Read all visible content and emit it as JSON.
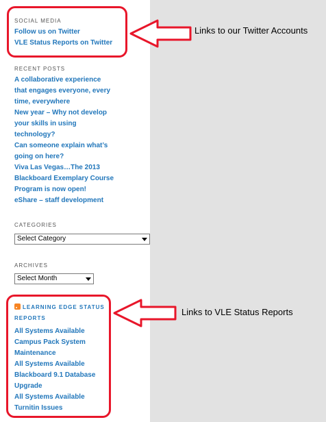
{
  "social_media": {
    "title": "SOCIAL MEDIA",
    "links": [
      "Follow us on Twitter",
      "VLE Status Reports on Twitter"
    ]
  },
  "recent_posts": {
    "title": "RECENT POSTS",
    "lines": [
      "A collaborative experience",
      "that engages everyone, every",
      "time, everywhere",
      "New year – Why not develop",
      "your skills in using",
      "technology?",
      "Can someone explain what’s",
      "going on here?",
      "Viva Las Vegas…The 2013",
      "Blackboard Exemplary Course",
      "Program is now open!",
      "eShare – staff development"
    ]
  },
  "categories": {
    "title": "CATEGORIES",
    "selected": "Select Category"
  },
  "archives": {
    "title": "ARCHIVES",
    "selected": "Select Month"
  },
  "status_reports": {
    "title": "LEARNING EDGE STATUS REPORTS",
    "icon": "rss-icon",
    "lines": [
      "All Systems Available",
      "Campus Pack System",
      "Maintenance",
      "All Systems Available",
      "Blackboard 9.1 Database",
      "Upgrade",
      "All Systems Available",
      "Turnitin Issues"
    ]
  },
  "annotations": {
    "twitter": "Links to our Twitter Accounts",
    "vle": "Links to VLE Status Reports"
  },
  "colors": {
    "link": "#2277bb",
    "highlight": "#e8162a",
    "background": "#e2e2e2"
  }
}
